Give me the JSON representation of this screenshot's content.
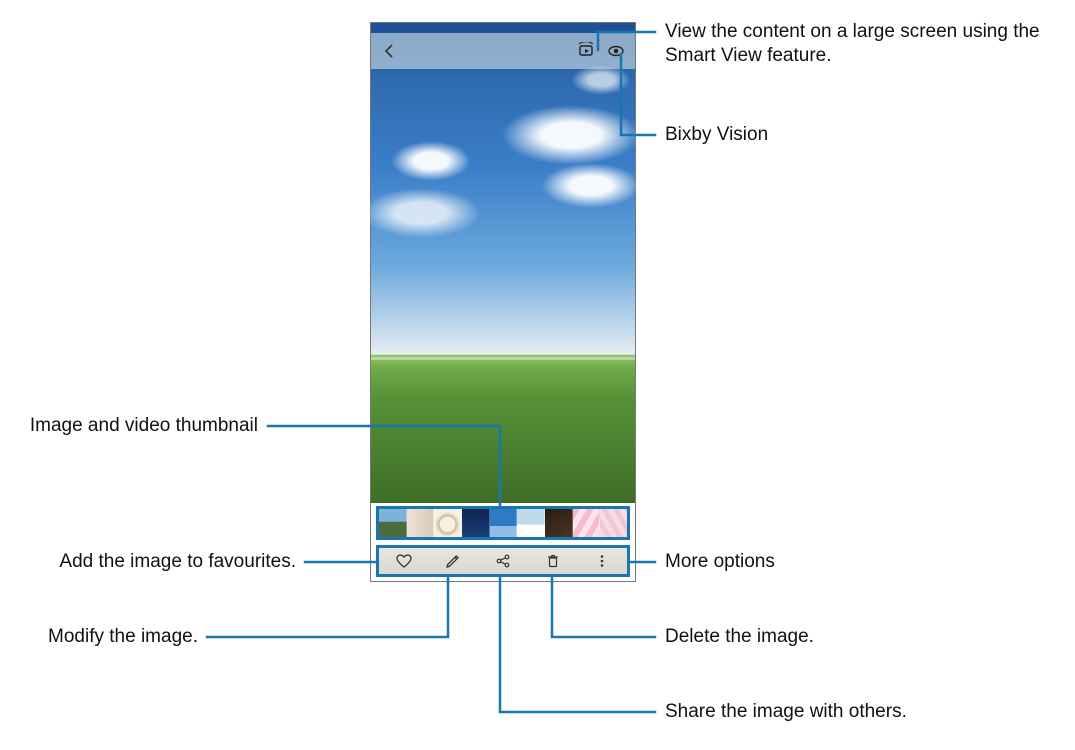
{
  "callouts": {
    "smart_view": "View the content on a large screen using the Smart View feature.",
    "bixby_vision": "Bixby Vision",
    "thumbnails": "Image and video thumbnail",
    "favourites": "Add the image to favourites.",
    "modify": "Modify the image.",
    "more": "More options",
    "delete": "Delete the image.",
    "share": "Share the image with others."
  },
  "leader_color": "#1976b0"
}
